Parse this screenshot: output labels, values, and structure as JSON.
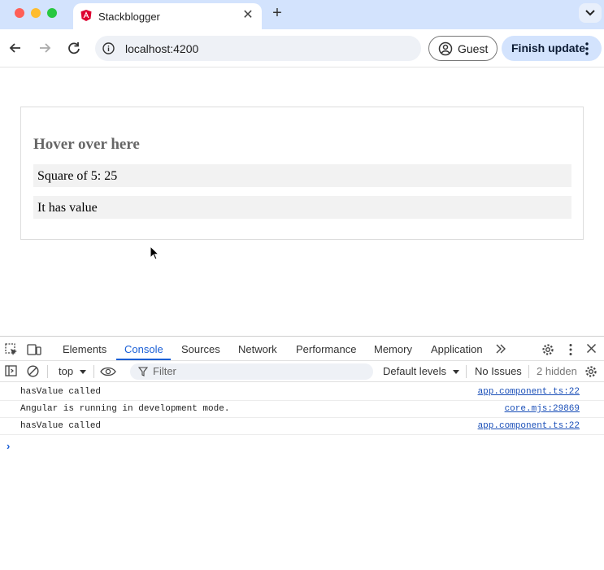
{
  "browser": {
    "tab_title": "Stackblogger",
    "new_tab_symbol": "+",
    "close_symbol": "✕",
    "url": "localhost:4200",
    "profile_label": "Guest",
    "update_label": "Finish update"
  },
  "page": {
    "heading": "Hover over here",
    "square_text": "Square of 5: 25",
    "value_text": "It has value"
  },
  "devtools": {
    "tabs": [
      "Elements",
      "Console",
      "Sources",
      "Network",
      "Performance",
      "Memory",
      "Application"
    ],
    "active_tab": "Console",
    "context": "top",
    "filter_placeholder": "Filter",
    "levels": "Default levels",
    "issues": "No Issues",
    "hidden": "2 hidden",
    "logs": [
      {
        "message": "hasValue called",
        "source": "app.component.ts:22"
      },
      {
        "message": "Angular is running in development mode.",
        "source": "core.mjs:29869"
      },
      {
        "message": "hasValue called",
        "source": "app.component.ts:22"
      }
    ],
    "prompt_symbol": "›"
  },
  "colors": {
    "accent": "#1a5fd6",
    "tabstrip": "#d3e3fd",
    "angular_logo": "#dd0031"
  }
}
